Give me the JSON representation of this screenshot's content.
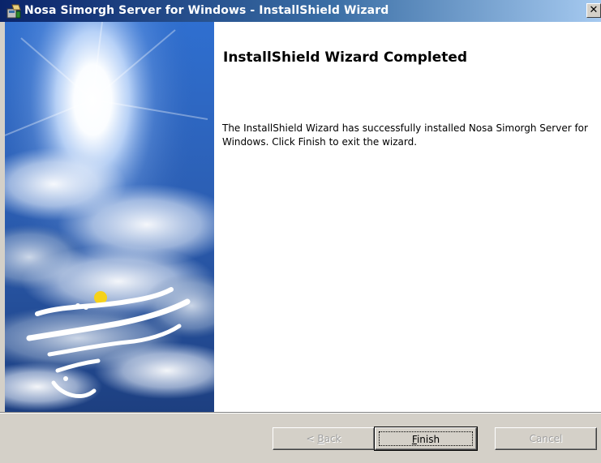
{
  "window": {
    "title": "Nosa Simorgh Server for Windows - InstallShield Wizard",
    "close_glyph": "✕",
    "icon": "installer-icon"
  },
  "content": {
    "heading": "InstallShield Wizard Completed",
    "message": "The InstallShield Wizard has successfully installed Nosa Simorgh Server for Windows. Click Finish to exit the wizard."
  },
  "buttons": {
    "back_prefix": "< ",
    "back_mnemonic": "B",
    "back_rest": "ack",
    "finish_mnemonic": "F",
    "finish_rest": "inish",
    "cancel": "Cancel"
  },
  "colors": {
    "titlebar_start": "#0a246a",
    "titlebar_end": "#a6caf0",
    "dialog_face": "#d4d0c8",
    "content_bg": "#ffffff",
    "disabled_text": "#a0a0a0"
  },
  "images": {
    "banner": "sky-with-sun-and-clouds",
    "logo": "simorgh-calligraphy-logo"
  }
}
